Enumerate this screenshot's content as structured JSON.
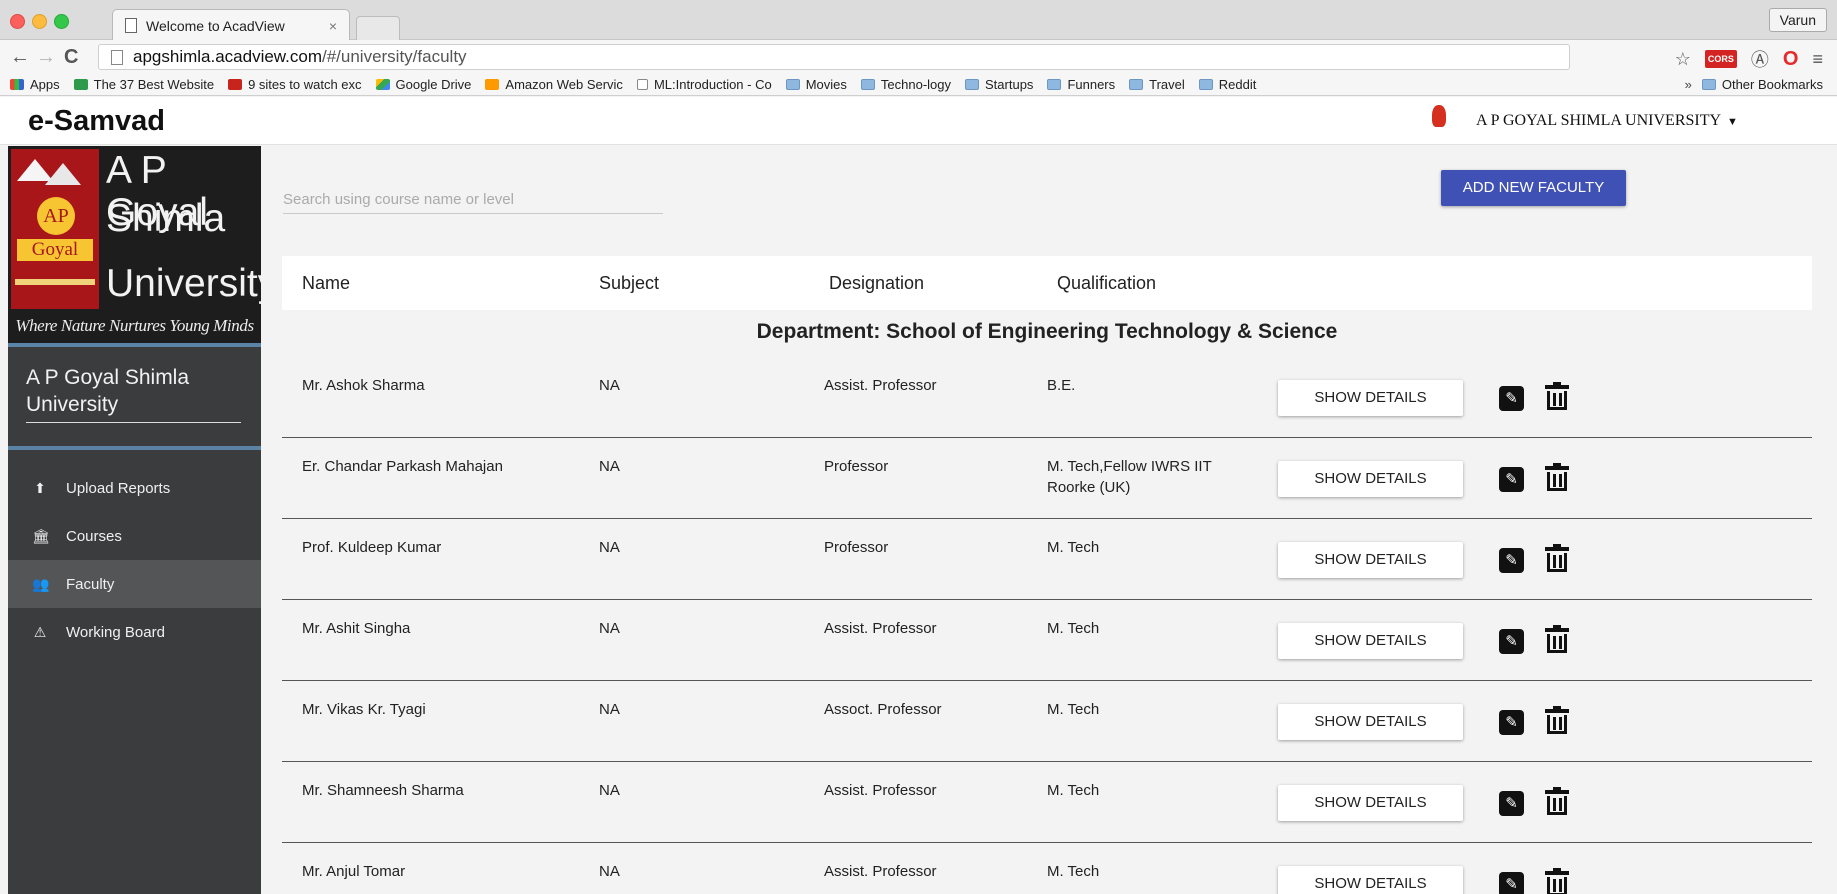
{
  "browser": {
    "tab_title": "Welcome to AcadView",
    "tab_close": "×",
    "profile": "Varun",
    "url_host": "apgshimla.acadview.com",
    "url_path": "/#/university/faculty",
    "bookmarks": [
      {
        "label": "Apps",
        "icon": "apps"
      },
      {
        "label": "The 37 Best Website",
        "icon": "m"
      },
      {
        "label": "9 sites to watch exc",
        "icon": "tvf"
      },
      {
        "label": "Google Drive",
        "icon": "gd"
      },
      {
        "label": "Amazon Web Servic",
        "icon": "amz"
      },
      {
        "label": "ML:Introduction - Co",
        "icon": "page"
      },
      {
        "label": "Movies",
        "icon": "folder"
      },
      {
        "label": "Techno-logy",
        "icon": "folder"
      },
      {
        "label": "Startups",
        "icon": "folder"
      },
      {
        "label": "Funners",
        "icon": "folder"
      },
      {
        "label": "Travel",
        "icon": "folder"
      },
      {
        "label": "Reddit",
        "icon": "folder"
      }
    ],
    "more_bookmarks": "»",
    "other_bookmarks": "Other Bookmarks",
    "cors_label": "CORS"
  },
  "header": {
    "brand": "e-Samvad",
    "university_menu": "A P GOYAL SHIMLA UNIVERSITY"
  },
  "sidebar": {
    "logo_lines": [
      "A P Goyal",
      "Shimla",
      "University"
    ],
    "logo_seal_top": "AP",
    "logo_seal_bottom": "Goyal",
    "tagline": "Where Nature Nurtures Young Minds",
    "university_name": "A P Goyal Shimla University",
    "items": [
      {
        "label": "Upload Reports",
        "icon": "upload-icon"
      },
      {
        "label": "Courses",
        "icon": "institution-icon"
      },
      {
        "label": "Faculty",
        "icon": "group-icon",
        "active": true
      },
      {
        "label": "Working Board",
        "icon": "warning-icon"
      }
    ]
  },
  "main": {
    "search_placeholder": "Search using course name or level",
    "add_button": "ADD NEW FACULTY",
    "columns": [
      "Name",
      "Subject",
      "Designation",
      "Qualification"
    ],
    "department": "Department: School of Engineering Technology & Science",
    "show_details_label": "SHOW DETAILS",
    "rows": [
      {
        "name": "Mr. Ashok Sharma",
        "subject": "NA",
        "designation": "Assist. Professor",
        "qualification": "B.E."
      },
      {
        "name": "Er. Chandar Parkash Mahajan",
        "subject": "NA",
        "designation": "Professor",
        "qualification": "M. Tech,Fellow IWRS IIT Roorke (UK)"
      },
      {
        "name": "Prof. Kuldeep Kumar",
        "subject": "NA",
        "designation": "Professor",
        "qualification": "M. Tech"
      },
      {
        "name": "Mr. Ashit Singha",
        "subject": "NA",
        "designation": "Assist. Professor",
        "qualification": "M. Tech"
      },
      {
        "name": "Mr. Vikas Kr. Tyagi",
        "subject": "NA",
        "designation": "Assoct. Professor",
        "qualification": "M. Tech"
      },
      {
        "name": "Mr. Shamneesh Sharma",
        "subject": "NA",
        "designation": "Assist. Professor",
        "qualification": "M. Tech"
      },
      {
        "name": "Mr. Anjul Tomar",
        "subject": "NA",
        "designation": "Assist. Professor",
        "qualification": "M. Tech"
      }
    ]
  },
  "colors": {
    "primary_button": "#3f51b5",
    "sidebar_bg": "#3b3c3e",
    "sidebar_active": "#545556",
    "logo_red": "#a8161a"
  }
}
